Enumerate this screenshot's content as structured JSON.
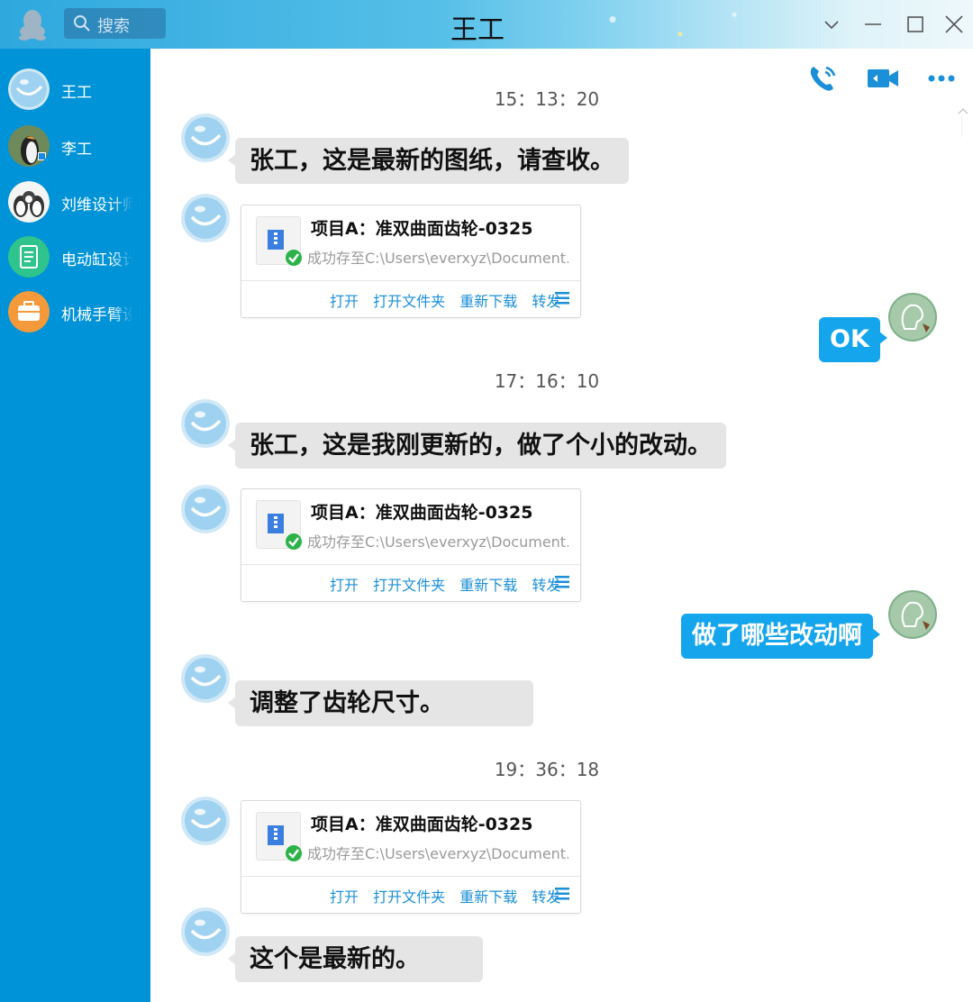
{
  "window": {
    "title": "王工",
    "search_placeholder": "搜索"
  },
  "sidebar": {
    "contacts": [
      {
        "name": "王工",
        "avatar": "cloud-smile"
      },
      {
        "name": "李工",
        "avatar": "penguin-photo"
      },
      {
        "name": "刘维设计师",
        "avatar": "penguins-group"
      },
      {
        "name": "电动缸设计",
        "avatar": "document-green"
      },
      {
        "name": "机械手臂设计",
        "avatar": "briefcase-orange"
      }
    ]
  },
  "chat": {
    "timestamps": [
      "15：13：20",
      "17：16：10",
      "19：36：18"
    ],
    "messages": [
      {
        "side": "left",
        "type": "text",
        "text": "张工，这是最新的图纸，请查收。"
      },
      {
        "side": "left",
        "type": "file",
        "file_name": "项目A：准双曲面齿轮-0325",
        "file_status": "成功存至C:\\Users\\everxyz\\Document..."
      },
      {
        "side": "right",
        "type": "text",
        "text": "OK"
      },
      {
        "side": "left",
        "type": "text",
        "text": "张工，这是我刚更新的，做了个小的改动。"
      },
      {
        "side": "left",
        "type": "file",
        "file_name": "项目A：准双曲面齿轮-0325",
        "file_status": "成功存至C:\\Users\\everxyz\\Document..."
      },
      {
        "side": "right",
        "type": "text",
        "text": "做了哪些改动啊"
      },
      {
        "side": "left",
        "type": "text",
        "text": "调整了齿轮尺寸。"
      },
      {
        "side": "left",
        "type": "file",
        "file_name": "项目A：准双曲面齿轮-0325",
        "file_status": "成功存至C:\\Users\\everxyz\\Document..."
      },
      {
        "side": "left",
        "type": "text",
        "text": "这个是最新的。"
      }
    ],
    "file_actions": {
      "open": "打开",
      "open_folder": "打开文件夹",
      "redownload": "重新下载",
      "forward": "转发"
    }
  },
  "colors": {
    "sidebar": "#0093d7",
    "bubble_left": "#e5e5e5",
    "bubble_right": "#14a5ed",
    "link": "#1b8fd8"
  },
  "icons": [
    "penguin-logo-icon",
    "search-icon",
    "chevron-down-icon",
    "minimize-icon",
    "maximize-icon",
    "close-icon",
    "phone-call-icon",
    "video-call-icon",
    "more-icon",
    "zip-file-icon",
    "check-icon",
    "menu-icon"
  ]
}
